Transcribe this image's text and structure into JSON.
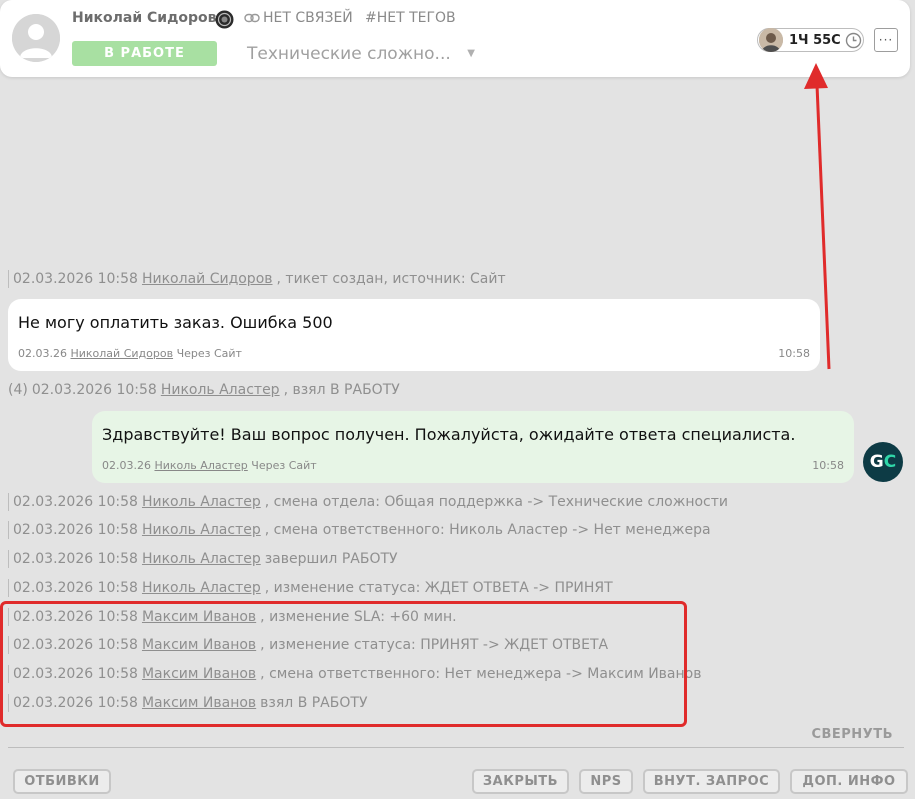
{
  "header": {
    "client_name": "Николай Сидоров",
    "links_label": "НЕТ СВЯЗЕЙ",
    "tags_label": "#НЕТ ТЕГОВ",
    "status_label": "В РАБОТЕ",
    "department": "Технические сложно...",
    "timer": "1Ч 55С",
    "more_label": "···"
  },
  "events_top": [
    {
      "datetime": "02.03.2026 10:58",
      "user": "Николай Сидоров",
      "action": ", тикет создан, источник: Сайт"
    }
  ],
  "messages": [
    {
      "text": "Не могу оплатить заказ. Ошибка 500",
      "date": "02.03.26",
      "author": "Николай Сидоров",
      "via": "Через Сайт",
      "time": "10:58"
    },
    {
      "text": "Здравствуйте! Ваш вопрос получен. Пожалуйста, ожидайте ответа специалиста.",
      "date": "02.03.26",
      "author": "Николь Аластер",
      "via": "Через Сайт",
      "time": "10:58"
    }
  ],
  "event_mid": {
    "prefix": "(4)",
    "datetime": "02.03.2026 10:58",
    "user": "Николь Аластер",
    "action": ", взял В РАБОТУ"
  },
  "events": [
    {
      "datetime": "02.03.2026 10:58",
      "user": "Николь Аластер",
      "action": ", смена отдела: Общая поддержка -> Технические сложности"
    },
    {
      "datetime": "02.03.2026 10:58",
      "user": "Николь Аластер",
      "action": ", смена ответственного: Николь Аластер -> Нет менеджера"
    },
    {
      "datetime": "02.03.2026 10:58",
      "user": "Николь Аластер",
      "action": "завершил РАБОТУ"
    },
    {
      "datetime": "02.03.2026 10:58",
      "user": "Николь Аластер",
      "action": ", изменение статуса: ЖДЕТ ОТВЕТА -> ПРИНЯТ"
    },
    {
      "datetime": "02.03.2026 10:58",
      "user": "Максим Иванов",
      "action": ", изменение SLA: +60 мин."
    },
    {
      "datetime": "02.03.2026 10:58",
      "user": "Максим Иванов",
      "action": ", изменение статуса: ПРИНЯТ -> ЖДЕТ ОТВЕТА"
    },
    {
      "datetime": "02.03.2026 10:58",
      "user": "Максим Иванов",
      "action": ", смена ответственного: Нет менеджера -> Максим Иванов"
    },
    {
      "datetime": "02.03.2026 10:58",
      "user": "Максим Иванов",
      "action": "взял В РАБОТУ"
    }
  ],
  "operator_avatar": {
    "initial_1": "G",
    "initial_2": "C"
  },
  "footer": {
    "collapse_label": "СВЕРНУТЬ",
    "buttons": [
      "ОТБИВКИ",
      "ЗАКРЫТЬ",
      "NPS",
      "ВНУТ. ЗАПРОС",
      "ДОП. ИНФО"
    ]
  },
  "colors": {
    "status_badge": "#a8e0a2",
    "annotation_red": "#e02b2b",
    "operator_message_bg": "#e7f5e6",
    "operator_avatar_bg": "#0d3b45",
    "operator_avatar_accent": "#2fd6a8"
  },
  "icons": [
    "user-avatar-icon",
    "site-channel-icon",
    "link-icon",
    "clock-icon",
    "more-icon"
  ]
}
